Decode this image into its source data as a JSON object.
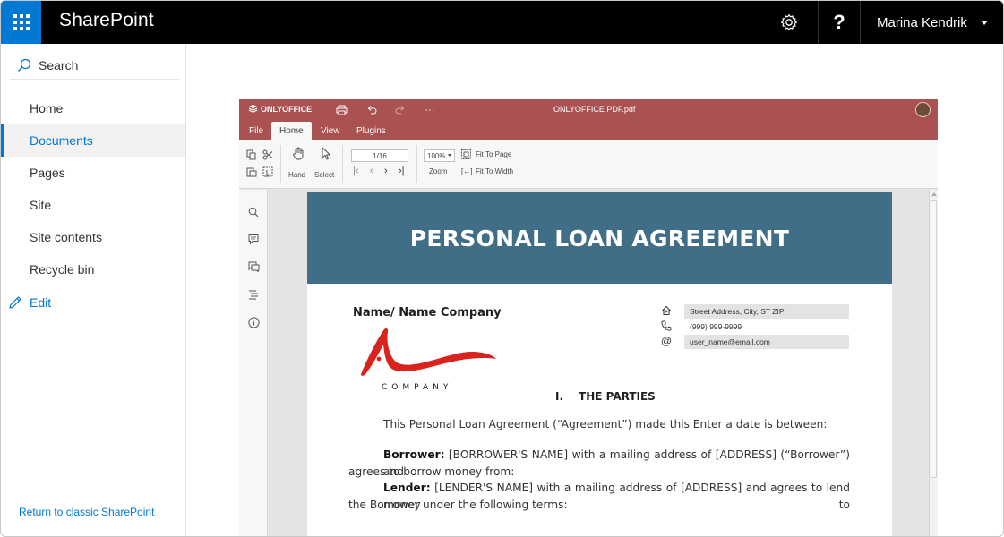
{
  "topbar": {
    "app_title": "SharePoint",
    "waffle_icon": "app-launcher-icon",
    "settings_icon": "gear-icon",
    "help_label": "?",
    "user_name": "Marina Kendrik",
    "accent": "#0078d4"
  },
  "leftnav": {
    "search_label": "Search",
    "items": [
      {
        "label": "Home"
      },
      {
        "label": "Documents",
        "active": true
      },
      {
        "label": "Pages"
      },
      {
        "label": "Site"
      },
      {
        "label": "Site contents"
      },
      {
        "label": "Recycle bin"
      }
    ],
    "edit_label": "Edit",
    "classic_link": "Return to classic SharePoint"
  },
  "editor": {
    "brand": "ONLYOFFICE",
    "doc_title": "ONLYOFFICE PDF.pdf",
    "header_color": "#aa5252",
    "more_label": "···",
    "tabs": [
      {
        "label": "File"
      },
      {
        "label": "Home",
        "active": true
      },
      {
        "label": "View"
      },
      {
        "label": "Plugins"
      }
    ],
    "toolbar": {
      "hand_label": "Hand",
      "select_label": "Select",
      "page_value": "1/16",
      "zoom_value": "100%",
      "zoom_label": "Zoom",
      "fit_page_label": "Fit To Page",
      "fit_width_label": "Fit To Width"
    }
  },
  "document": {
    "title": "PERSONAL LOAN AGREEMENT",
    "banner_color": "#416e87",
    "company_name": "Name/ Name Company",
    "logo_word": "COMPANY",
    "logo_color": "#d9231f",
    "contact": {
      "address": "Street Address, City, ST  ZIP",
      "phone": "(999) 999-9999",
      "email": "user_name@email.com"
    },
    "section_number": "I.",
    "section_title": "THE PARTIES",
    "intro": "This Personal Loan Agreement (“Agreement”) made this Enter a date is between:",
    "borrower_label": "Borrower:",
    "borrower_line1": "[BORROWER'S NAME] with a mailing address of [ADDRESS] (“Borrower”) and",
    "borrower_line2": "agrees to borrow money from:",
    "lender_label": "Lender:",
    "lender_line1": "[LENDER'S NAME] with a mailing address of [ADDRESS] and agrees to lend money to",
    "lender_line2": "the Borrower under the following terms:"
  }
}
